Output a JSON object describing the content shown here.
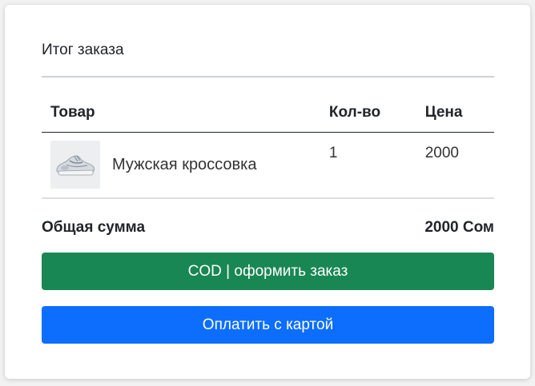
{
  "summary": {
    "title": "Итог заказа"
  },
  "table": {
    "headers": {
      "product": "Товар",
      "quantity": "Кол-во",
      "price": "Цена"
    },
    "rows": [
      {
        "product_name": "Мужская кроссовка",
        "product_image": "sneaker-image",
        "quantity": "1",
        "price": "2000"
      }
    ]
  },
  "total": {
    "label": "Общая сумма",
    "value": "2000 Сом"
  },
  "buttons": {
    "cod_label": "COD | оформить заказ",
    "card_label": "Оплатить с картой"
  },
  "colors": {
    "cod_button": "#198754",
    "card_button": "#0d6efd"
  }
}
